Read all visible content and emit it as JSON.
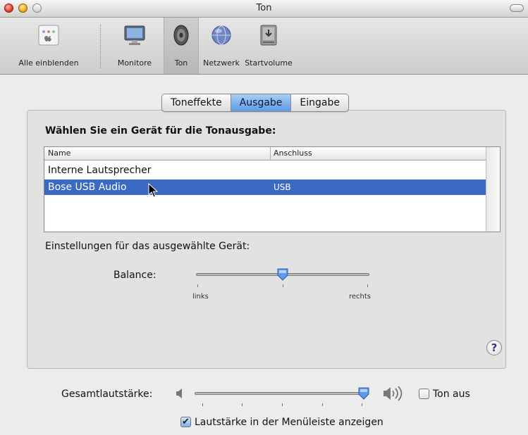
{
  "window": {
    "title": "Ton"
  },
  "toolbar": {
    "items": [
      {
        "label": "Alle einblenden",
        "icon": "apple-grid-icon",
        "selected": false
      },
      {
        "label": "Monitore",
        "icon": "monitor-icon",
        "selected": false
      },
      {
        "label": "Ton",
        "icon": "speaker-icon",
        "selected": true
      },
      {
        "label": "Netzwerk",
        "icon": "globe-icon",
        "selected": false
      },
      {
        "label": "Startvolume",
        "icon": "hard-drive-icon",
        "selected": false
      }
    ]
  },
  "tabs": [
    {
      "label": "Toneffekte",
      "active": false
    },
    {
      "label": "Ausgabe",
      "active": true
    },
    {
      "label": "Eingabe",
      "active": false
    }
  ],
  "output": {
    "title": "Wählen Sie ein Gerät für die Tonausgabe:",
    "columns": [
      "Name",
      "Anschluss"
    ],
    "devices": [
      {
        "name": "Interne Lautsprecher",
        "connection": "",
        "selected": false
      },
      {
        "name": "Bose USB Audio",
        "connection": "USB",
        "selected": true
      }
    ],
    "settings_label": "Einstellungen für das ausgewählte Gerät:",
    "balance": {
      "label": "Balance:",
      "left_label": "links",
      "right_label": "rechts",
      "value": 0.5
    }
  },
  "help": {
    "label": "?"
  },
  "volume": {
    "label": "Gesamtlautstärke:",
    "value": 1.0,
    "mute_label": "Ton aus",
    "mute_checked": false,
    "menubar_label": "Lautstärke in der Menüleiste anzeigen",
    "menubar_checked": true
  },
  "colors": {
    "selection": "#3b6ac2",
    "tab_active": "#5d9ae5",
    "knob": "#5b9ae8"
  }
}
